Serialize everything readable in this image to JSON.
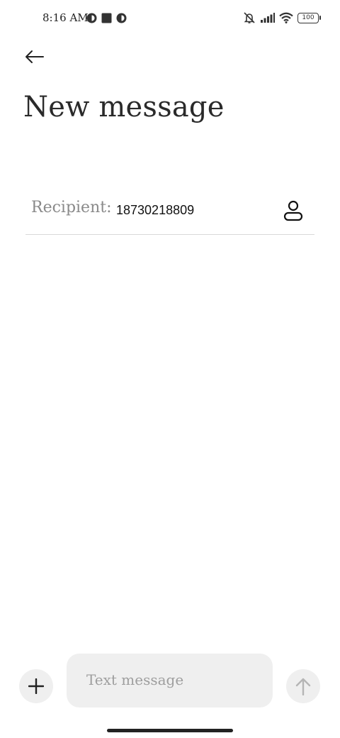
{
  "status_bar": {
    "time": "8:16 AM",
    "battery": "100",
    "left_icons": [
      "app-notification-icon",
      "square-notification-icon",
      "app-notification-icon"
    ],
    "right_icons": [
      "vibrate-off-icon",
      "signal-icon",
      "wifi-icon",
      "battery-icon"
    ]
  },
  "header": {
    "back_icon": "arrow-left-icon",
    "title": "New message"
  },
  "recipient": {
    "label": "Recipient:",
    "value": "18730218809",
    "contact_icon": "person-icon"
  },
  "composer": {
    "add_icon": "plus-icon",
    "placeholder": "Text message",
    "send_icon": "arrow-up-icon"
  },
  "colors": {
    "background": "#ffffff",
    "composer_bg": "#efefef",
    "label_gray": "#8a8a8a",
    "divider": "#d9d9d9",
    "send_disabled": "#b5b5b5"
  }
}
